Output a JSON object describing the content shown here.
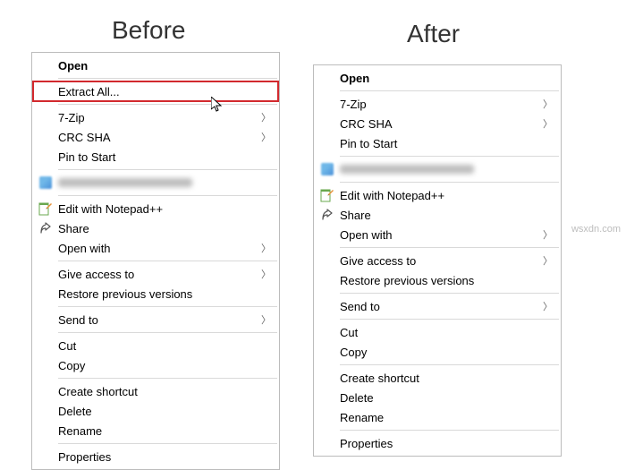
{
  "titles": {
    "before": "Before",
    "after": "After"
  },
  "watermark": "wsxdn.com",
  "before_menu": {
    "open": "Open",
    "extract_all": "Extract All...",
    "seven_zip": "7-Zip",
    "crc_sha": "CRC SHA",
    "pin_to_start": "Pin to Start",
    "edit_notepad": "Edit with Notepad++",
    "share": "Share",
    "open_with": "Open with",
    "give_access_to": "Give access to",
    "restore_prev": "Restore previous versions",
    "send_to": "Send to",
    "cut": "Cut",
    "copy": "Copy",
    "create_shortcut": "Create shortcut",
    "delete": "Delete",
    "rename": "Rename",
    "properties": "Properties"
  },
  "after_menu": {
    "open": "Open",
    "seven_zip": "7-Zip",
    "crc_sha": "CRC SHA",
    "pin_to_start": "Pin to Start",
    "edit_notepad": "Edit with Notepad++",
    "share": "Share",
    "open_with": "Open with",
    "give_access_to": "Give access to",
    "restore_prev": "Restore previous versions",
    "send_to": "Send to",
    "cut": "Cut",
    "copy": "Copy",
    "create_shortcut": "Create shortcut",
    "delete": "Delete",
    "rename": "Rename",
    "properties": "Properties"
  }
}
